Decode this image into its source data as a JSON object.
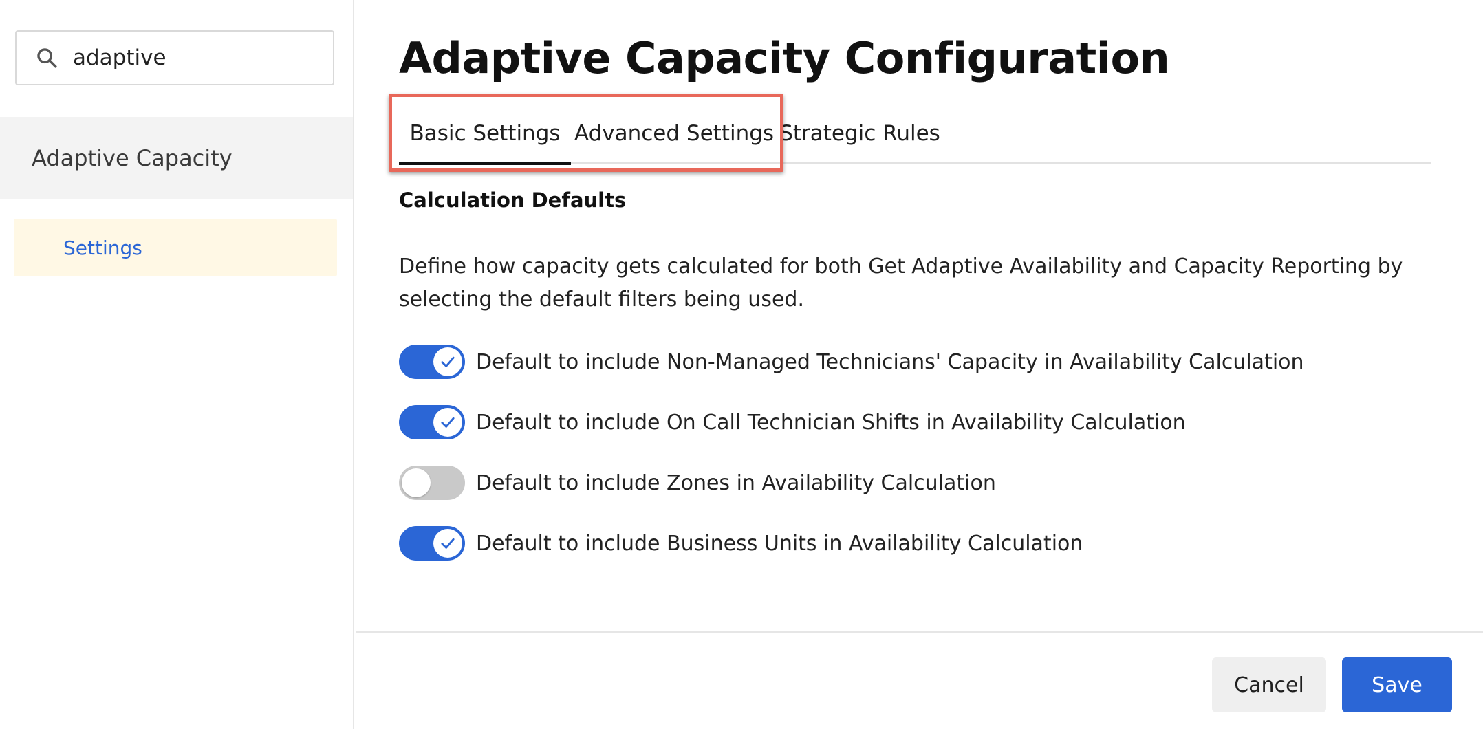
{
  "sidebar": {
    "search": {
      "value": "adaptive",
      "icon": "search-icon"
    },
    "group_label": "Adaptive Capacity",
    "items": [
      {
        "label": "Settings",
        "selected": true
      }
    ]
  },
  "main": {
    "title": "Adaptive Capacity Configuration",
    "tabs": [
      {
        "label": "Basic Settings",
        "active": true
      },
      {
        "label": "Advanced Settings",
        "active": false
      },
      {
        "label": "Strategic Rules",
        "active": false
      }
    ],
    "section": {
      "title": "Calculation Defaults",
      "description": "Define how capacity gets calculated for both Get Adaptive Availability and Capacity Reporting by selecting the default filters being used."
    },
    "toggles": [
      {
        "label": "Default to include Non-Managed Technicians' Capacity in Availability Calculation",
        "on": true
      },
      {
        "label": "Default to include On Call Technician Shifts in Availability Calculation",
        "on": true
      },
      {
        "label": "Default to include Zones in Availability Calculation",
        "on": false
      },
      {
        "label": "Default to include Business Units in Availability Calculation",
        "on": true
      }
    ]
  },
  "footer": {
    "cancel_label": "Cancel",
    "save_label": "Save"
  },
  "colors": {
    "accent": "#2b66d6",
    "highlight_outline": "#e8685a",
    "selected_item_bg": "#fff8e5",
    "toggle_off": "#c9c9c9"
  }
}
